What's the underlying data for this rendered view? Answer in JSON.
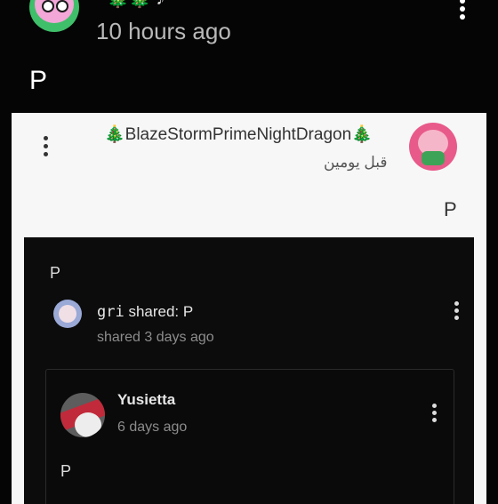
{
  "post": {
    "username": "🎄🎄 ♪",
    "time": "10 hours ago",
    "body": "P"
  },
  "shared_post": {
    "username": "🎄BlazeStormPrimeNightDragon🎄",
    "time": "قبل يومين",
    "body": "P",
    "inner": {
      "body": "P",
      "share": {
        "user": "gri",
        "shared_label": "shared: P",
        "time": "shared 3 days ago"
      },
      "comment": {
        "user": "Yusietta",
        "time": "6 days ago",
        "body": "P"
      }
    }
  },
  "icons": {
    "menu": "more-vertical-icon"
  }
}
